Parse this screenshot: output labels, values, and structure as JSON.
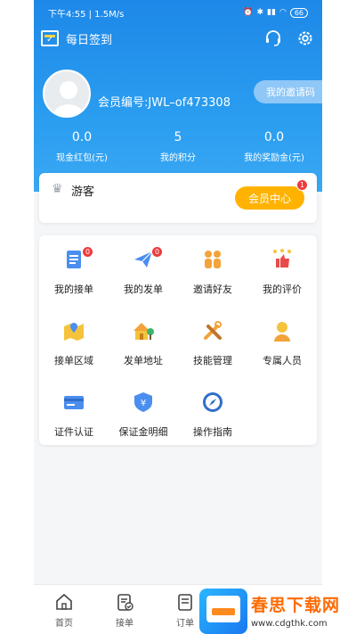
{
  "status_bar": {
    "time_speed": "下午4:55 | 1.5M/s",
    "battery": "66"
  },
  "topbar": {
    "checkin_label": "每日签到"
  },
  "profile": {
    "member_id": "会员编号:JWL–of473308",
    "invite_label": "我的邀请码"
  },
  "stats": [
    {
      "value": "0.0",
      "label": "现金红包(元)"
    },
    {
      "value": "5",
      "label": "我的积分"
    },
    {
      "value": "0.0",
      "label": "我的奖励金(元)"
    }
  ],
  "vip": {
    "level_label": "游客",
    "center_button": "会员中心",
    "center_badge": "1"
  },
  "menu": [
    {
      "label": "我的接单",
      "icon": "document-icon",
      "badge": "0"
    },
    {
      "label": "我的发单",
      "icon": "paper-plane-icon",
      "badge": "0"
    },
    {
      "label": "邀请好友",
      "icon": "friends-icon",
      "badge": ""
    },
    {
      "label": "我的评价",
      "icon": "thumbs-up-icon",
      "badge": ""
    },
    {
      "label": "接单区域",
      "icon": "map-pin-icon",
      "badge": ""
    },
    {
      "label": "发单地址",
      "icon": "house-icon",
      "badge": ""
    },
    {
      "label": "技能管理",
      "icon": "tools-icon",
      "badge": ""
    },
    {
      "label": "专属人员",
      "icon": "person-icon",
      "badge": ""
    },
    {
      "label": "证件认证",
      "icon": "id-card-icon",
      "badge": ""
    },
    {
      "label": "保证金明细",
      "icon": "shield-yen-icon",
      "badge": ""
    },
    {
      "label": "操作指南",
      "icon": "compass-icon",
      "badge": ""
    }
  ],
  "tabs": [
    {
      "label": "首页",
      "icon": "home-icon"
    },
    {
      "label": "接单",
      "icon": "clipboard-check-icon"
    },
    {
      "label": "订单",
      "icon": "order-icon"
    }
  ],
  "watermark": {
    "title": "春思下载网",
    "url": "www.cdgthk.com"
  }
}
